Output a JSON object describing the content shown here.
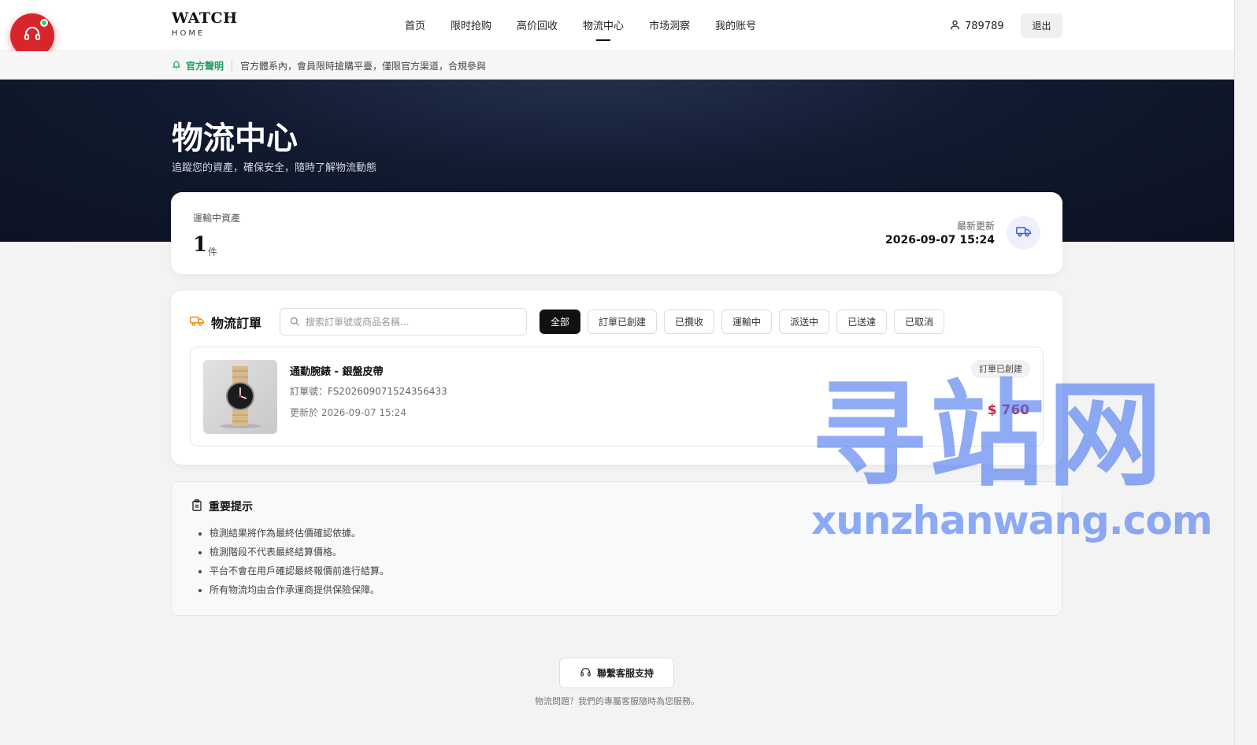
{
  "brand": {
    "name": "WATCH",
    "sub": "HOME"
  },
  "nav": [
    "首页",
    "限时抢购",
    "高价回收",
    "物流中心",
    "市场洞察",
    "我的账号"
  ],
  "nav_active": "物流中心",
  "user": {
    "id": "789789",
    "logout": "退出"
  },
  "support": {
    "tag": "客服",
    "accent": "#d8252b"
  },
  "notice": {
    "label": "官方聲明",
    "text": "官方體系內，會員限時搶購平臺，僅限官方渠道，合規參與"
  },
  "hero": {
    "title": "物流中心",
    "subtitle": "追蹤您的資產，確保安全，隨時了解物流動態"
  },
  "stats": {
    "label": "運輸中資產",
    "value": "1",
    "unit": "件",
    "updated_label": "最新更新",
    "updated_value": "2026-09-07 15:24"
  },
  "orders": {
    "title": "物流訂單",
    "search_placeholder": "搜索訂單號或商品名稱...",
    "filters": [
      "全部",
      "訂單已創建",
      "已攬收",
      "運輸中",
      "派送中",
      "已送達",
      "已取消"
    ],
    "active_filter": "全部",
    "items": [
      {
        "name": "通勤腕錶 - 銀盤皮帶",
        "order_no": "訂單號：FS202609071524356433",
        "updated": "更新於 2026-09-07 15:24",
        "status": "訂單已創建",
        "price": "$ 760"
      }
    ]
  },
  "tips": {
    "title": "重要提示",
    "items": [
      "檢測結果將作為最終估價確認依據。",
      "檢測階段不代表最終結算價格。",
      "平台不會在用戶確認最終報價前進行結算。",
      "所有物流均由合作承運商提供保險保障。"
    ]
  },
  "footer": {
    "button": "聯繫客服支持",
    "note": "物流問題？我們的專屬客服隨時為您服務。"
  },
  "watermark": {
    "big": "寻站网",
    "small": "xunzhanwang.com"
  },
  "colors": {
    "price": "#c2223f",
    "notice": "#1f9e5a",
    "hero_bg": "#0c1222",
    "truck": "#3b5bdb",
    "orders_icon": "#f08c1a"
  }
}
